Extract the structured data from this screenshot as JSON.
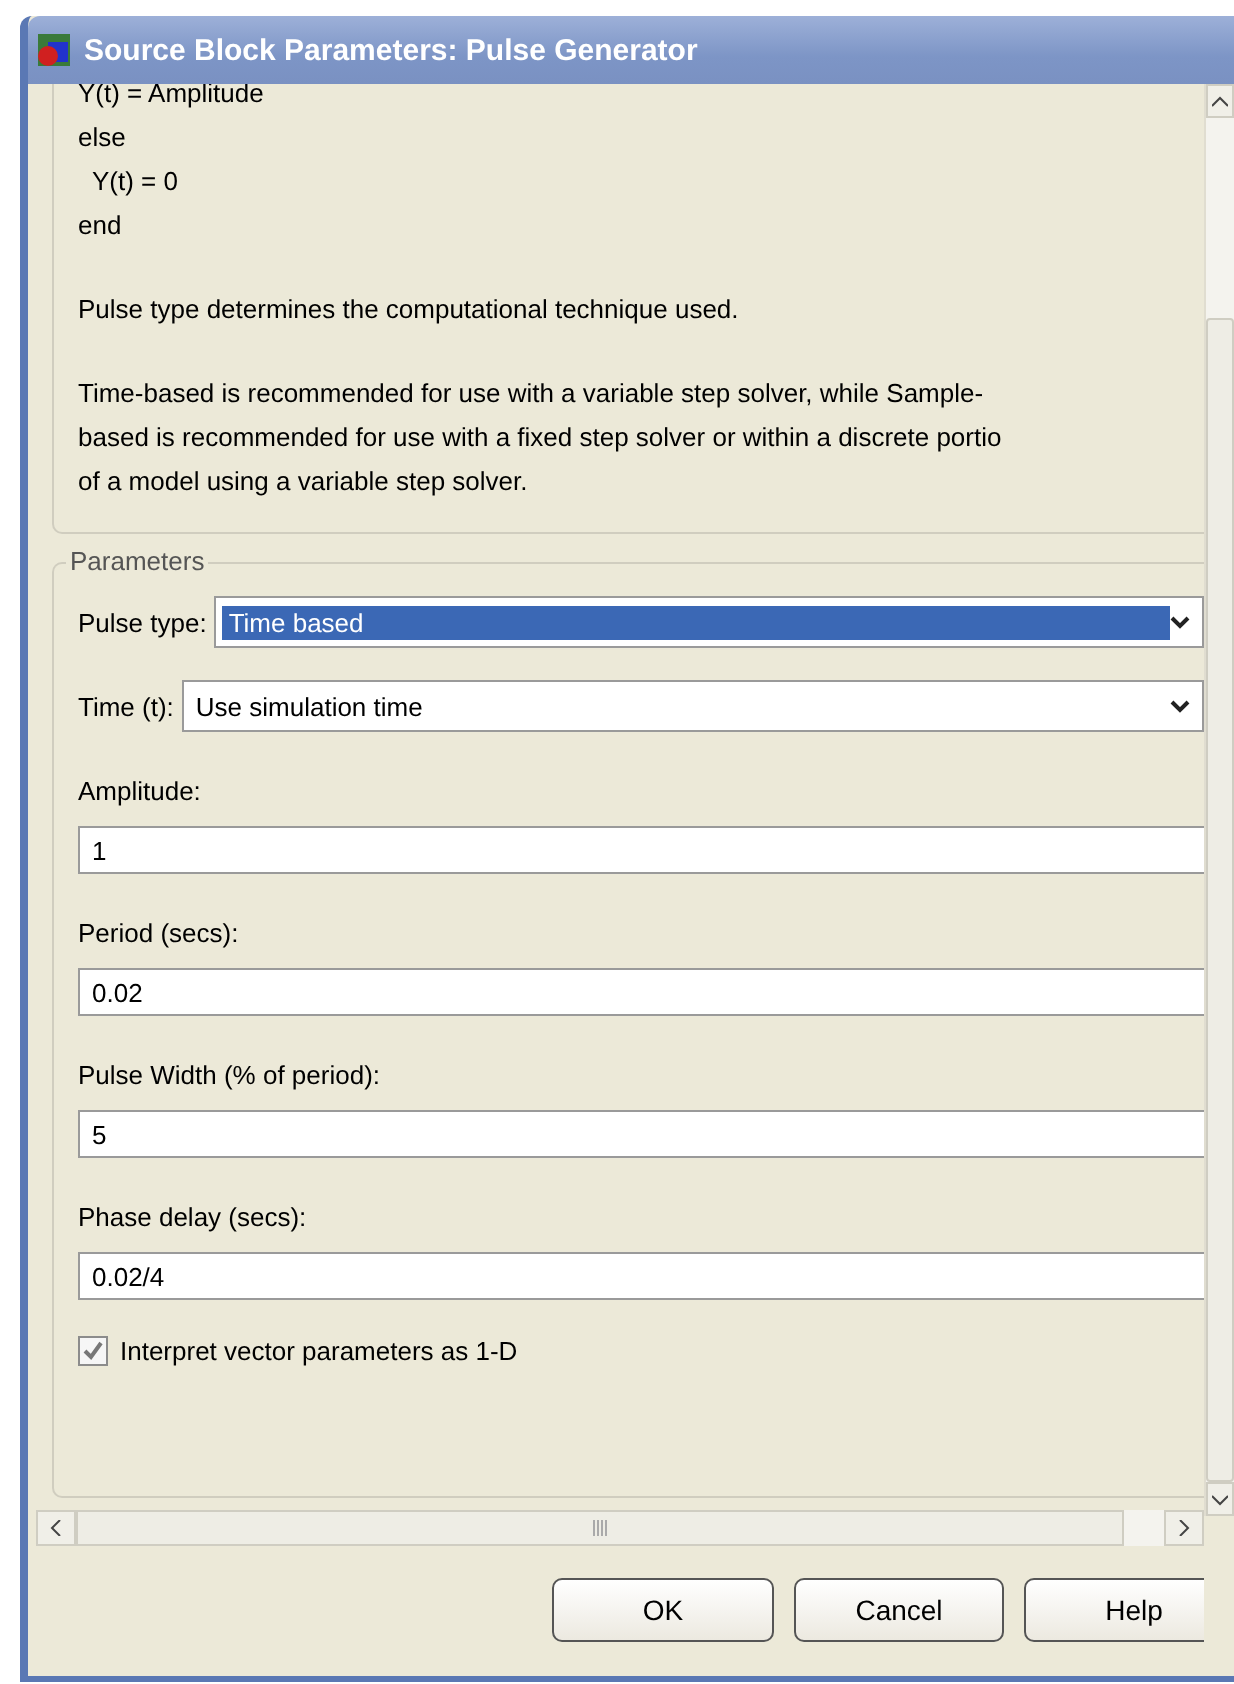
{
  "window": {
    "title": "Source Block Parameters: Pulse Generator"
  },
  "description": {
    "code_lines": [
      "Y(t) = Amplitude",
      "else",
      "  Y(t) = 0",
      "end"
    ],
    "paragraphs": [
      "Pulse type determines the computational technique used.",
      "Time-based is recommended for use with a variable step solver, while Sample-\nbased is recommended for use with a fixed step solver or within a discrete portio\nof a model using a variable step solver."
    ]
  },
  "parameters": {
    "legend": "Parameters",
    "dropdowns": [
      {
        "label": "Pulse type:",
        "value": "Time based",
        "focused": true
      },
      {
        "label": "Time (t):",
        "value": "Use simulation time",
        "focused": false
      }
    ],
    "fields": [
      {
        "label": "Amplitude:",
        "value": "1"
      },
      {
        "label": "Period (secs):",
        "value": "0.02"
      },
      {
        "label": "Pulse Width (% of period):",
        "value": "5"
      },
      {
        "label": "Phase delay (secs):",
        "value": "0.02/4"
      }
    ],
    "checkbox": {
      "label": "Interpret vector parameters as 1-D",
      "checked": true
    }
  },
  "buttons": [
    "OK",
    "Cancel",
    "Help"
  ]
}
